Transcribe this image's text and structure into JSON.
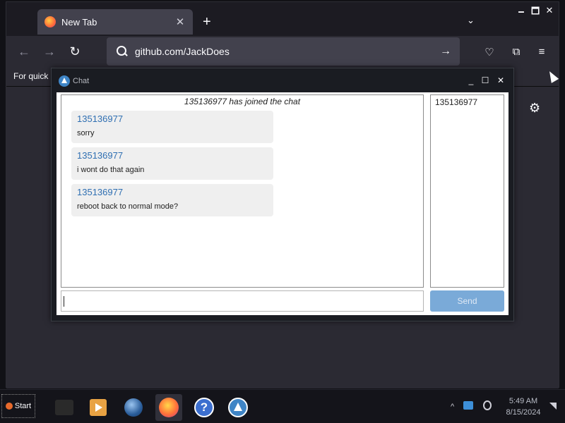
{
  "browser": {
    "tab_title": "New Tab",
    "tab_close": "✕",
    "new_tab": "+",
    "tab_list": "⌄",
    "window_controls": {
      "minimize": "🗕",
      "maximize": "🗖",
      "close": "✕"
    },
    "nav": {
      "back": "←",
      "forward": "→",
      "reload": "↻"
    },
    "url": "github.com/JackDoes",
    "go": "→",
    "toolbar": {
      "pocket": "♡",
      "extensions": "⧉",
      "menu": "≡"
    },
    "bookmarks_hint": "For quick",
    "settings": "⚙"
  },
  "chat": {
    "window_title": "Chat",
    "controls": {
      "minimize": "_",
      "maximize": "☐",
      "close": "✕"
    },
    "joined_notice": "135136977 has joined the chat",
    "messages": [
      {
        "user": "135136977",
        "text": "sorry"
      },
      {
        "user": "135136977",
        "text": "i wont do that again"
      },
      {
        "user": "135136977",
        "text": "reboot back to normal mode?"
      }
    ],
    "users": [
      "135136977"
    ],
    "input_value": "",
    "send_label": "Send"
  },
  "taskbar": {
    "start_label": "Start",
    "apps": [
      "terminal",
      "media-player",
      "browser-globe",
      "firefox",
      "help",
      "chat"
    ],
    "tray": {
      "chevron": "^"
    },
    "clock_time": "5:49 AM",
    "clock_date": "8/15/2024"
  }
}
